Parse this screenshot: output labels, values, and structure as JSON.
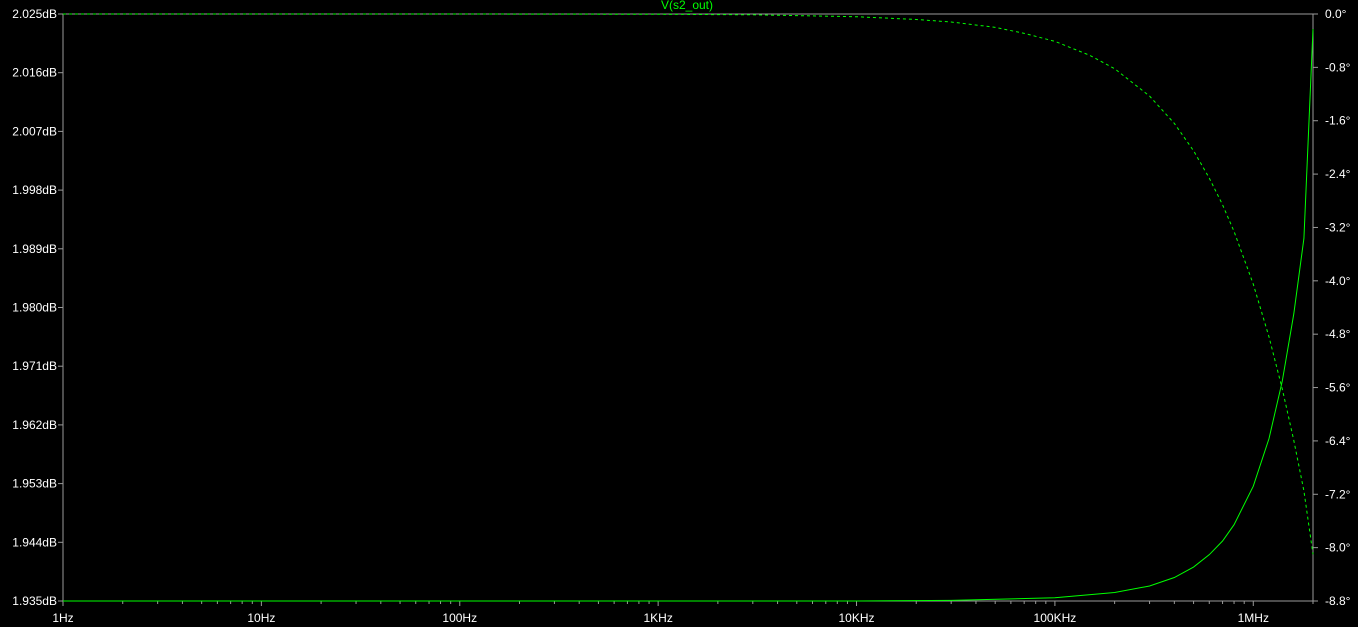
{
  "chart_data": {
    "type": "line",
    "title": "V(s2_out)",
    "x_scale": "log",
    "xlim": [
      1,
      2000000
    ],
    "x_ticks": [
      {
        "value": 1,
        "label": "1Hz"
      },
      {
        "value": 10,
        "label": "10Hz"
      },
      {
        "value": 100,
        "label": "100Hz"
      },
      {
        "value": 1000,
        "label": "1KHz"
      },
      {
        "value": 10000,
        "label": "10KHz"
      },
      {
        "value": 100000,
        "label": "100KHz"
      },
      {
        "value": 1000000,
        "label": "1MHz"
      }
    ],
    "y_left": {
      "unit": "dB",
      "ylim": [
        1.935,
        2.025
      ],
      "ticks": [
        {
          "value": 2.025,
          "label": "2.025dB"
        },
        {
          "value": 2.016,
          "label": "2.016dB"
        },
        {
          "value": 2.007,
          "label": "2.007dB"
        },
        {
          "value": 1.998,
          "label": "1.998dB"
        },
        {
          "value": 1.989,
          "label": "1.989dB"
        },
        {
          "value": 1.98,
          "label": "1.980dB"
        },
        {
          "value": 1.971,
          "label": "1.971dB"
        },
        {
          "value": 1.962,
          "label": "1.962dB"
        },
        {
          "value": 1.953,
          "label": "1.953dB"
        },
        {
          "value": 1.944,
          "label": "1.944dB"
        },
        {
          "value": 1.935,
          "label": "1.935dB"
        }
      ]
    },
    "y_right": {
      "unit": "°",
      "ylim": [
        -8.8,
        0
      ],
      "ticks": [
        {
          "value": 0.0,
          "label": "0.0°"
        },
        {
          "value": -0.8,
          "label": "-0.8°"
        },
        {
          "value": -1.6,
          "label": "-1.6°"
        },
        {
          "value": -2.4,
          "label": "-2.4°"
        },
        {
          "value": -3.2,
          "label": "-3.2°"
        },
        {
          "value": -4.0,
          "label": "-4.0°"
        },
        {
          "value": -4.8,
          "label": "-4.8°"
        },
        {
          "value": -5.6,
          "label": "-5.6°"
        },
        {
          "value": -6.4,
          "label": "-6.4°"
        },
        {
          "value": -7.2,
          "label": "-7.2°"
        },
        {
          "value": -8.0,
          "label": "-8.0°"
        },
        {
          "value": -8.8,
          "label": "-8.8°"
        }
      ]
    },
    "grid": false,
    "series": [
      {
        "name": "V(s2_out)",
        "axis": "left",
        "style": "solid",
        "color": "#00ff00",
        "x": [
          1,
          10,
          100,
          1000,
          10000,
          30000,
          100000,
          200000,
          300000,
          400000,
          500000,
          600000,
          700000,
          800000,
          1000000,
          1200000,
          1400000,
          1600000,
          1800000,
          2000000
        ],
        "y": [
          1.935,
          1.935,
          1.935,
          1.935,
          1.935,
          1.9351,
          1.9355,
          1.9363,
          1.9373,
          1.9386,
          1.9402,
          1.9421,
          1.9442,
          1.9467,
          1.9526,
          1.9599,
          1.9687,
          1.979,
          1.9906,
          2.0227
        ]
      },
      {
        "axis": "right",
        "style": "dashed",
        "color": "#00ff00",
        "x": [
          1,
          10,
          100,
          1000,
          3000,
          10000,
          20000,
          30000,
          50000,
          70000,
          100000,
          150000,
          200000,
          300000,
          400000,
          500000,
          600000,
          700000,
          800000,
          1000000,
          1200000,
          1400000,
          1600000,
          1800000,
          2000000
        ],
        "y": [
          0.0,
          0.0,
          0.0,
          -0.004,
          -0.012,
          -0.041,
          -0.082,
          -0.12,
          -0.2,
          -0.29,
          -0.41,
          -0.62,
          -0.82,
          -1.23,
          -1.64,
          -2.05,
          -2.46,
          -2.86,
          -3.26,
          -4.05,
          -4.84,
          -5.62,
          -6.39,
          -7.15,
          -8.1
        ]
      }
    ]
  }
}
